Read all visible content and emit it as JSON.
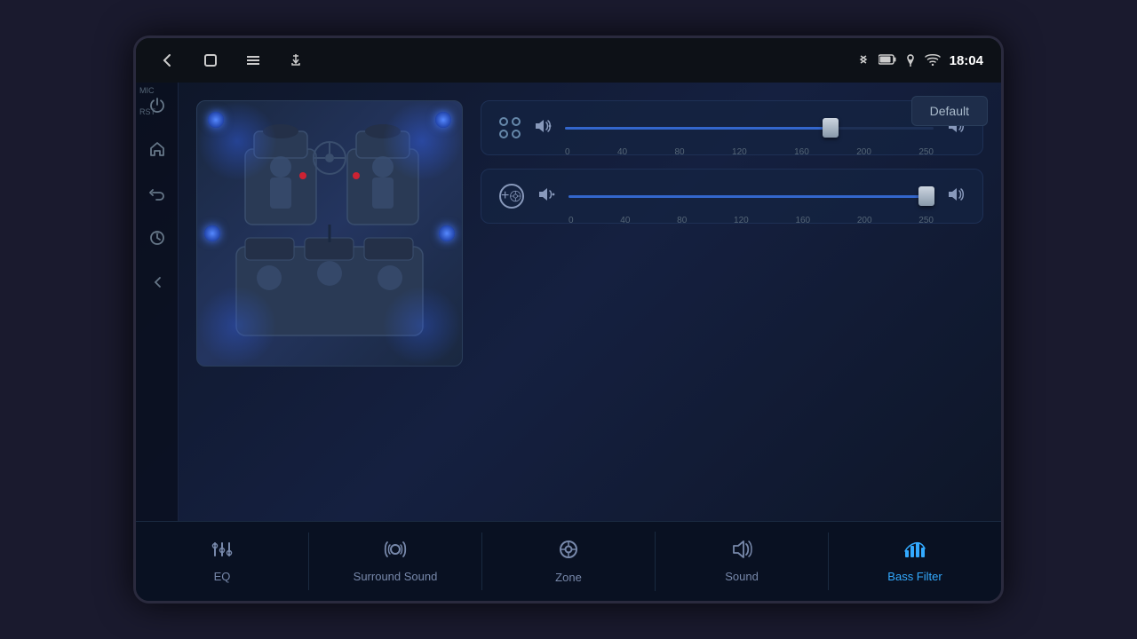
{
  "statusBar": {
    "time": "18:04",
    "bluetooth_icon": "bluetooth",
    "battery_icon": "battery",
    "location_icon": "location",
    "wifi_icon": "wifi"
  },
  "sidebar": {
    "mic_label": "MIC",
    "rst_label": "RST",
    "icons": [
      "power",
      "home",
      "back",
      "navigate",
      "return"
    ]
  },
  "main": {
    "default_button": "Default",
    "sliders": [
      {
        "id": "slider1",
        "fill_percent": 72,
        "thumb_percent": 72,
        "ticks": [
          "0",
          "40",
          "80",
          "120",
          "160",
          "200",
          "250"
        ]
      },
      {
        "id": "slider2",
        "fill_percent": 98,
        "thumb_percent": 98,
        "ticks": [
          "0",
          "40",
          "80",
          "120",
          "160",
          "200",
          "250"
        ]
      }
    ]
  },
  "bottomNav": {
    "tabs": [
      {
        "id": "eq",
        "label": "EQ",
        "icon": "⚙",
        "active": false
      },
      {
        "id": "surround",
        "label": "Surround Sound",
        "icon": "◎",
        "active": false
      },
      {
        "id": "zone",
        "label": "Zone",
        "icon": "◎",
        "active": false
      },
      {
        "id": "sound",
        "label": "Sound",
        "icon": "🔊",
        "active": false
      },
      {
        "id": "bass",
        "label": "Bass Filter",
        "icon": "📊",
        "active": true
      }
    ]
  }
}
